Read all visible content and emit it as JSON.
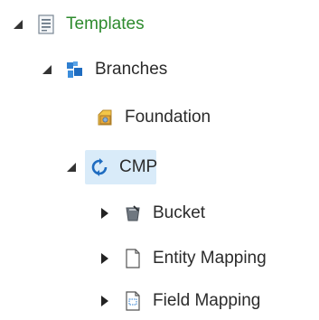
{
  "tree": {
    "items": [
      {
        "label": "Templates",
        "icon": "templates-icon",
        "state": "expanded",
        "selected": false
      },
      {
        "label": "Branches",
        "icon": "branches-icon",
        "state": "expanded",
        "selected": false
      },
      {
        "label": "Foundation",
        "icon": "foundation-icon",
        "state": "leaf",
        "selected": false
      },
      {
        "label": "CMP",
        "icon": "cmp-sync-icon",
        "state": "expanded",
        "selected": true
      },
      {
        "label": "Bucket",
        "icon": "bucket-icon",
        "state": "collapsed",
        "selected": false
      },
      {
        "label": "Entity Mapping",
        "icon": "document-icon",
        "state": "collapsed",
        "selected": false
      },
      {
        "label": "Field Mapping",
        "icon": "field-document-icon",
        "state": "collapsed",
        "selected": false
      }
    ]
  },
  "colors": {
    "selected_background": "#d9ebf9",
    "templates_label": "#2e8b2e",
    "text": "#2b2b2b"
  }
}
